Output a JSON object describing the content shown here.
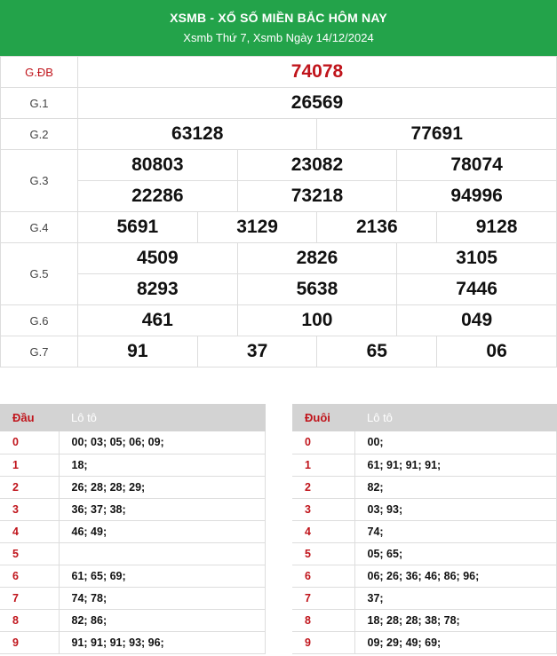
{
  "header": {
    "title": "XSMB - XỔ SỐ MIỀN BẮC HÔM NAY",
    "subtitle": "Xsmb Thứ 7, Xsmb Ngày 14/12/2024"
  },
  "prizes": {
    "gdb": {
      "label": "G.ĐB",
      "numbers": [
        "74078"
      ]
    },
    "g1": {
      "label": "G.1",
      "numbers": [
        "26569"
      ]
    },
    "g2": {
      "label": "G.2",
      "numbers": [
        "63128",
        "77691"
      ]
    },
    "g3": {
      "label": "G.3",
      "numbers": [
        "80803",
        "23082",
        "78074",
        "22286",
        "73218",
        "94996"
      ]
    },
    "g4": {
      "label": "G.4",
      "numbers": [
        "5691",
        "3129",
        "2136",
        "9128"
      ]
    },
    "g5": {
      "label": "G.5",
      "numbers": [
        "4509",
        "2826",
        "3105",
        "8293",
        "5638",
        "7446"
      ]
    },
    "g6": {
      "label": "G.6",
      "numbers": [
        "461",
        "100",
        "049"
      ]
    },
    "g7": {
      "label": "G.7",
      "numbers": [
        "91",
        "37",
        "65",
        "06"
      ]
    }
  },
  "dau": {
    "head_col1": "Đầu",
    "head_col2": "Lô tô",
    "rows": [
      {
        "key": "0",
        "value": "00; 03; 05; 06; 09;"
      },
      {
        "key": "1",
        "value": "18;"
      },
      {
        "key": "2",
        "value": "26; 28; 28; 29;"
      },
      {
        "key": "3",
        "value": "36; 37; 38;"
      },
      {
        "key": "4",
        "value": "46; 49;"
      },
      {
        "key": "5",
        "value": ""
      },
      {
        "key": "6",
        "value": "61; 65; 69;"
      },
      {
        "key": "7",
        "value": "74; 78;"
      },
      {
        "key": "8",
        "value": "82; 86;"
      },
      {
        "key": "9",
        "value": "91; 91; 91; 93; 96;"
      }
    ]
  },
  "duoi": {
    "head_col1": "Đuôi",
    "head_col2": "Lô tô",
    "rows": [
      {
        "key": "0",
        "value": "00;"
      },
      {
        "key": "1",
        "value": "61; 91; 91; 91;"
      },
      {
        "key": "2",
        "value": "82;"
      },
      {
        "key": "3",
        "value": "03; 93;"
      },
      {
        "key": "4",
        "value": "74;"
      },
      {
        "key": "5",
        "value": "05; 65;"
      },
      {
        "key": "6",
        "value": "06; 26; 36; 46; 86; 96;"
      },
      {
        "key": "7",
        "value": "37;"
      },
      {
        "key": "8",
        "value": "18; 28; 28; 38; 78;"
      },
      {
        "key": "9",
        "value": "09; 29; 49; 69;"
      }
    ]
  },
  "colors": {
    "header_green": "#23a34a",
    "special_red": "#c0141b",
    "table_header_gray": "#d3d3d3"
  }
}
